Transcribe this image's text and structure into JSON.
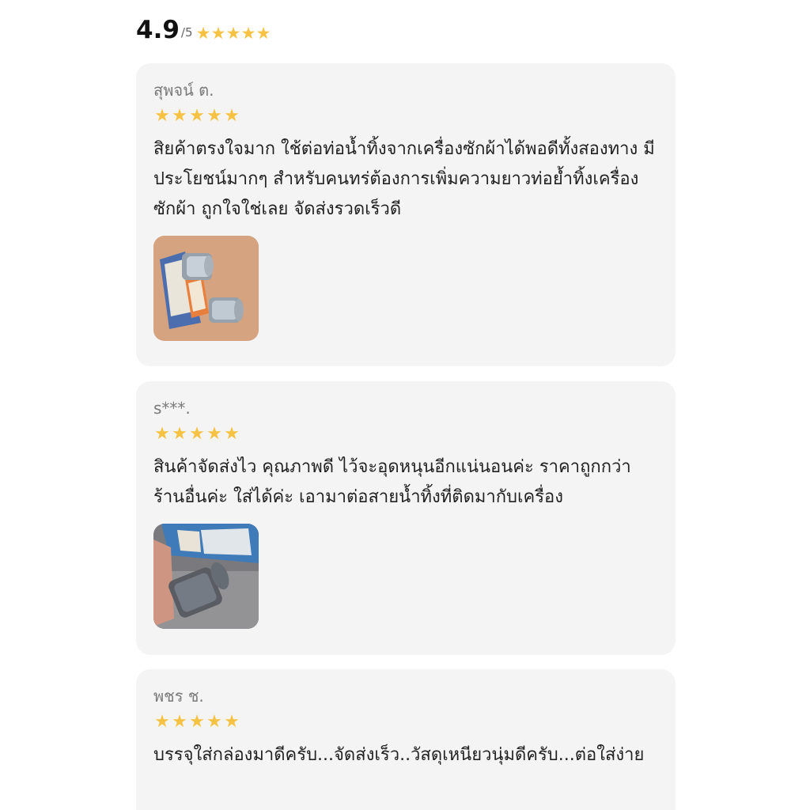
{
  "summary": {
    "rating": "4.9",
    "max": "/5",
    "stars": 5
  },
  "colors": {
    "star": "#f6c243",
    "card_background": "#f4f4f4",
    "reviewer_name": "#7a7a7a"
  },
  "reviews": [
    {
      "reviewer": "สุพจน์ ต.",
      "stars": 5,
      "text": "สิยค้าตรงใจมาก ใช้ต่อท่อน้ำทิ้งจากเครื่องซักผ้าได้พอดีทั้งสองทาง มีประโยชน์มากๆ สำหรับคนทร่ต้องการเพิ่มความยาวท่อย้ำทิ้งเครื่องซักผ้า ถูกใจใช่เลย จัดส่งรวดเร็วดี",
      "photo": "product-photo"
    },
    {
      "reviewer": "s***.",
      "stars": 5,
      "text": "สินค้าจัดส่งไว คุณภาพดี ไว้จะอุดหนุนอีกแน่นอนค่ะ ราคาถูกกว่าร้านอื่นค่ะ ใส่ได้ค่ะ เอามาต่อสายน้ำทิ้งที่ติดมากับเครื่อง",
      "photo": "product-photo"
    },
    {
      "reviewer": "พชร ช.",
      "stars": 5,
      "text": "บรรจุใส่กล่องมาดีครับ...จัดส่งเร็ว..วัสดุเหนียวนุ่มดีครับ...ต่อใส่ง่าย"
    }
  ]
}
